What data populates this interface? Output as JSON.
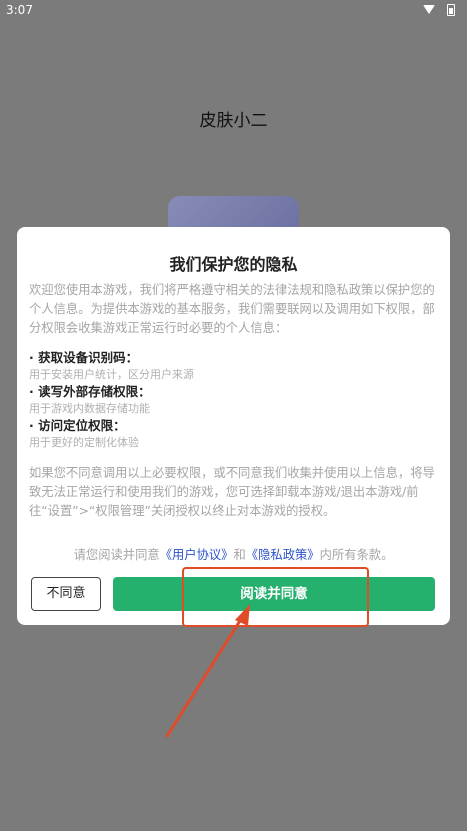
{
  "status_bar": {
    "time": "3:07",
    "wifi_icon": "wifi-icon",
    "battery_icon": "battery-icon"
  },
  "app": {
    "title": "皮肤小二"
  },
  "dialog": {
    "title": "我们保护您的隐私",
    "intro": "欢迎您使用本游戏，我们将严格遵守相关的法律法规和隐私政策以保护您的个人信息。为提供本游戏的基本服务，我们需要联网以及调用如下权限，部分权限会收集游戏正常运行时必要的个人信息：",
    "permissions": [
      {
        "title": "· 获取设备识别码：",
        "desc": "用于安装用户统计，区分用户来源"
      },
      {
        "title": "· 读写外部存储权限：",
        "desc": "用于游戏内数据存储功能"
      },
      {
        "title": "· 访问定位权限：",
        "desc": "用于更好的定制化体验"
      }
    ],
    "notice": "如果您不同意调用以上必要权限，或不同意我们收集并使用以上信息，将导致无法正常运行和使用我们的游戏，您可选择卸载本游戏/退出本游戏/前往“设置”>“权限管理”关闭授权以终止对本游戏的授权。",
    "agree_prefix": "请您阅读并同意",
    "user_agreement": "《用户协议》",
    "agree_and": "和",
    "privacy_policy": "《隐私政策》",
    "agree_suffix": "内所有条款。",
    "disagree_label": "不同意",
    "agree_label": "阅读并同意"
  },
  "colors": {
    "overlay": "#7b7b7b",
    "accent_green": "#26b06e",
    "annotation_red": "#e04b2a",
    "link_blue": "#2b52c8"
  }
}
